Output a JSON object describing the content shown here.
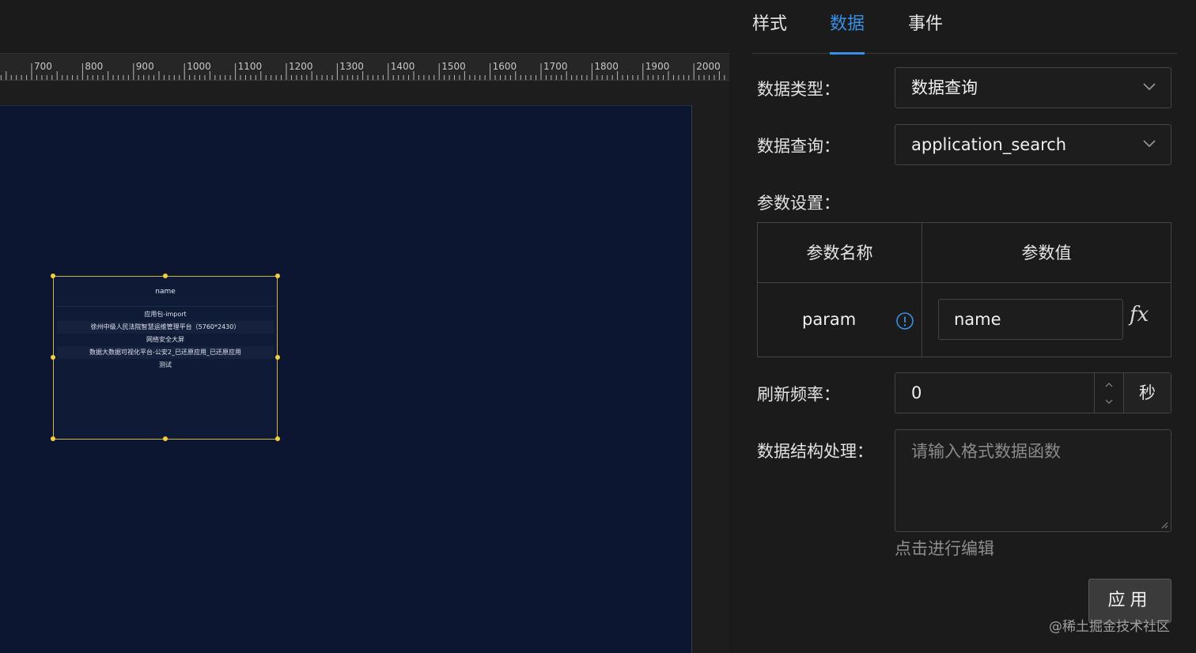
{
  "ruler": {
    "labels": [
      "700",
      "800",
      "900",
      "1000",
      "1100",
      "1200",
      "1300",
      "1400",
      "1500",
      "1600",
      "1700",
      "1800",
      "1900",
      "2000"
    ]
  },
  "widget": {
    "header": "name",
    "rows": [
      "应用包-import",
      "徐州中级人民法院智慧运维管理平台（5760*2430）",
      "网络安全大屏",
      "数据大数据可视化平台-公安2_已还原应用_已还原应用",
      "测试"
    ]
  },
  "panel": {
    "tabs": [
      "样式",
      "数据",
      "事件"
    ],
    "active_tab": "数据",
    "data_type": {
      "label": "数据类型：",
      "value": "数据查询"
    },
    "data_query": {
      "label": "数据查询：",
      "value": "application_search"
    },
    "params": {
      "label": "参数设置：",
      "col_name": "参数名称",
      "col_value": "参数值",
      "rows": [
        {
          "name": "param",
          "value": "name",
          "fx": "fx"
        }
      ]
    },
    "refresh": {
      "label": "刷新频率：",
      "value": "0",
      "unit": "秒"
    },
    "struct": {
      "label": "数据结构处理：",
      "placeholder": "请输入格式数据函数",
      "edit_link": "点击进行编辑"
    },
    "apply_label": "应用",
    "watermark": "@稀土掘金技术社区"
  },
  "colors": {
    "accent": "#3a8ee6",
    "canvas": "#0c1631",
    "selection": "#f4d03f"
  }
}
